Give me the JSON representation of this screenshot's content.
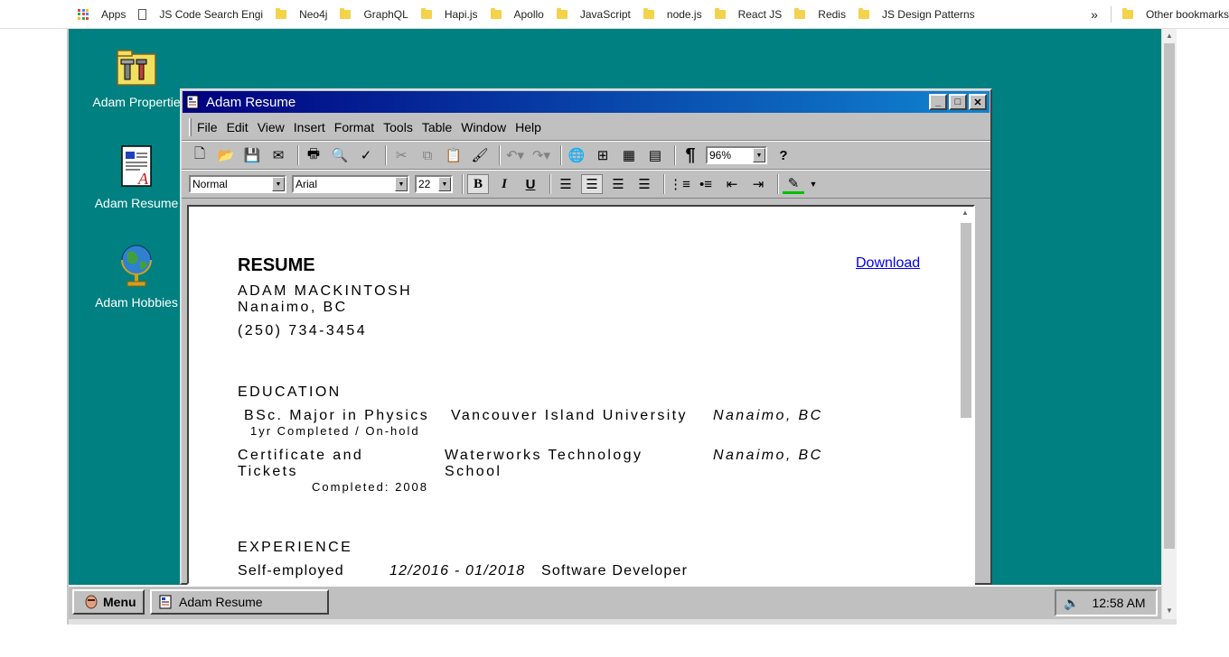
{
  "bookmarks": {
    "apps_label": "Apps",
    "items": [
      "JS Code Search Engi",
      "Neo4j",
      "GraphQL",
      "Hapi.js",
      "Apollo",
      "JavaScript",
      "node.js",
      "React JS",
      "Redis",
      "JS Design Patterns"
    ],
    "more": "»",
    "other": "Other bookmarks"
  },
  "desktop": {
    "icons": [
      {
        "label": "Adam Propertie",
        "icon": "properties-icon"
      },
      {
        "label": "Adam Resume",
        "icon": "resume-doc-icon"
      },
      {
        "label": "Adam Hobbies",
        "icon": "globe-icon"
      }
    ]
  },
  "window": {
    "title": "Adam Resume",
    "menu": [
      "File",
      "Edit",
      "View",
      "Insert",
      "Format",
      "Tools",
      "Table",
      "Window",
      "Help"
    ],
    "zoom": "96%",
    "style": "Normal",
    "font": "Arial",
    "size": "22"
  },
  "resume": {
    "title": "RESUME",
    "download": "Download",
    "name": "ADAM MACKINTOSH",
    "location": "Nanaimo, BC",
    "phone": "(250) 734-3454",
    "education_heading": "EDUCATION",
    "edu1_degree": "BSc. Major in Physics",
    "edu1_school": "Vancouver Island University",
    "edu1_place": "Nanaimo, BC",
    "edu1_note": "1yr Completed / On-hold",
    "edu2_degree_l1": "Certificate and",
    "edu2_degree_l2": "Tickets",
    "edu2_school_l1": "Waterworks Technology",
    "edu2_school_l2": "School",
    "edu2_place": "Nanaimo, BC",
    "edu2_note": "Completed: 2008",
    "experience_heading": "EXPERIENCE",
    "exp1_company": "Self-employed",
    "exp1_dates": "12/2016 - 01/2018",
    "exp1_role": "Software Developer"
  },
  "taskbar": {
    "menu": "Menu",
    "task": "Adam Resume",
    "time": "12:58 AM"
  }
}
